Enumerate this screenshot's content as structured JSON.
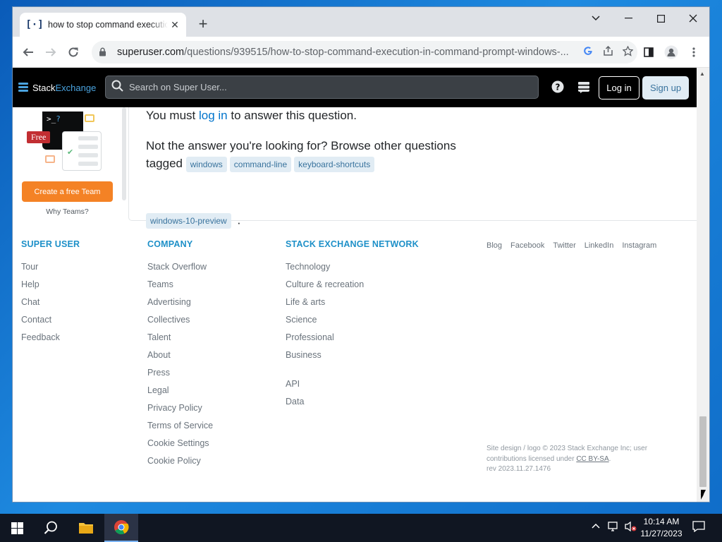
{
  "browser": {
    "tab_title": "how to stop command execution in command prompt windows",
    "tab_favicon": "[·]",
    "url_host": "superuser.com",
    "url_path": "/questions/939515/how-to-stop-command-execution-in-command-prompt-windows-..."
  },
  "header": {
    "logo_stack": "Stack",
    "logo_exchange": "Exchange",
    "search_placeholder": "Search on Super User...",
    "login_label": "Log in",
    "signup_label": "Sign up"
  },
  "teams": {
    "terminal_text": ">_",
    "terminal_q": "?",
    "free_badge": "Free",
    "cta_label": "Create a free Team",
    "why_label": "Why Teams?"
  },
  "answer": {
    "must_prefix": "You must",
    "login_link": "log in",
    "must_suffix": "to answer this question.",
    "browse_text": "Not the answer you're looking for? Browse other questions tagged",
    "tags": [
      "windows",
      "command-line",
      "keyboard-shortcuts",
      "windows-10-preview"
    ],
    "end_period": "."
  },
  "footer": {
    "superuser": {
      "title": "SUPER USER",
      "links": [
        "Tour",
        "Help",
        "Chat",
        "Contact",
        "Feedback"
      ]
    },
    "company": {
      "title": "COMPANY",
      "links": [
        "Stack Overflow",
        "Teams",
        "Advertising",
        "Collectives",
        "Talent",
        "About",
        "Press",
        "Legal",
        "Privacy Policy",
        "Terms of Service",
        "Cookie Settings",
        "Cookie Policy"
      ]
    },
    "network": {
      "title": "STACK EXCHANGE NETWORK",
      "links": [
        "Technology",
        "Culture & recreation",
        "Life & arts",
        "Science",
        "Professional",
        "Business"
      ],
      "links2": [
        "API",
        "Data"
      ]
    },
    "social": [
      "Blog",
      "Facebook",
      "Twitter",
      "LinkedIn",
      "Instagram"
    ],
    "copyright_1": "Site design / logo © 2023 Stack Exchange Inc; user contributions licensed under",
    "license": "CC BY-SA",
    "copyright_2": ".",
    "rev": "rev 2023.11.27.1476"
  },
  "taskbar": {
    "time": "10:14 AM",
    "date": "11/27/2023"
  },
  "colors": {
    "accent_link": "#0074cc",
    "footer_heading": "#1e90c8",
    "orange_cta": "#f48225",
    "tag_bg": "#e1ecf4"
  }
}
